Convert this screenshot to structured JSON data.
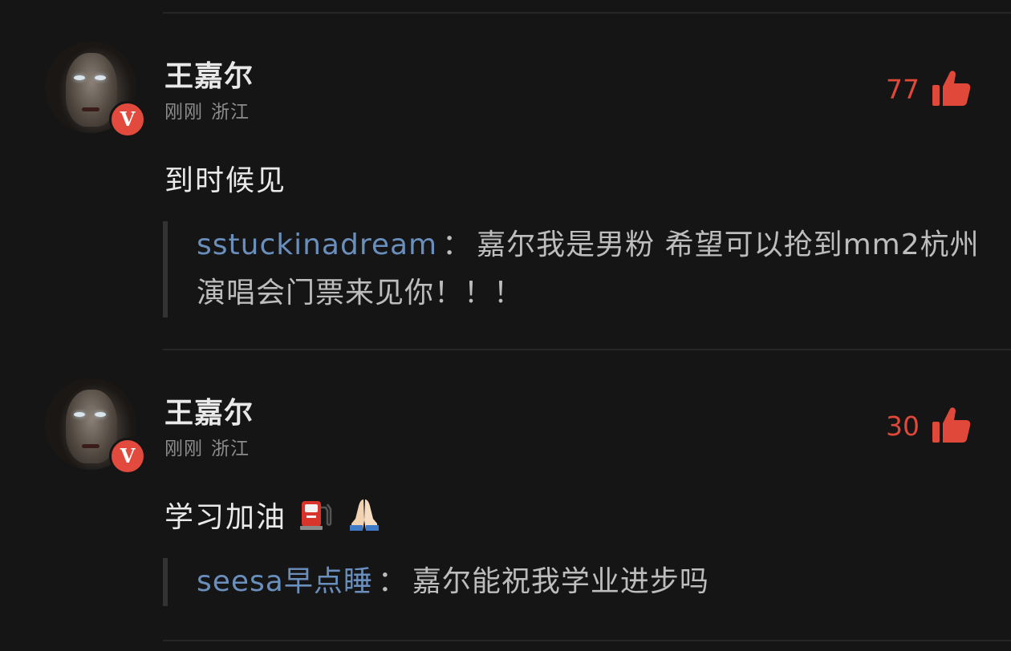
{
  "colors": {
    "background": "#151515",
    "accent_like": "#e0483a",
    "quote_user": "#6a8fbd",
    "badge": "#e14a3c"
  },
  "comments": [
    {
      "username": "王嘉尔",
      "time": "刚刚",
      "location": "浙江",
      "likes": "77",
      "text": "到时候见",
      "emojis": [],
      "reply": {
        "user": "sstuckinadream",
        "separator": "：",
        "text": "嘉尔我是男粉 希望可以抢到mm2杭州演唱会门票来见你！！！"
      }
    },
    {
      "username": "王嘉尔",
      "time": "刚刚",
      "location": "浙江",
      "likes": "30",
      "text": "学习加油",
      "emojis": [
        "fuel-pump-emoji",
        "folded-hands-emoji"
      ],
      "reply": {
        "user": "seesa早点睡",
        "separator": "：",
        "text": "嘉尔能祝我学业进步吗"
      }
    }
  ],
  "icons": {
    "avatar": "avatar-image",
    "verified": "V",
    "like": "thumbs-up-icon"
  }
}
